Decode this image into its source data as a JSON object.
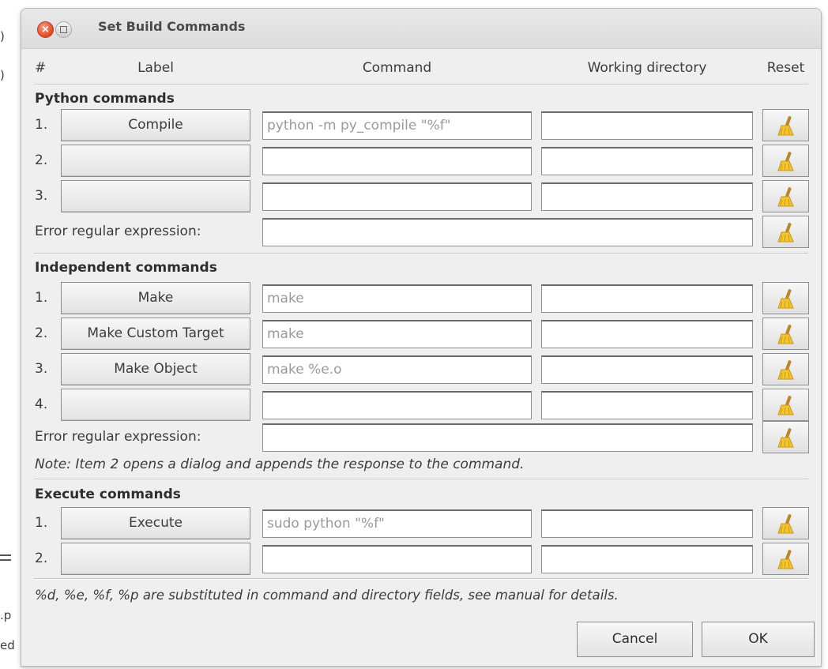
{
  "background": {
    "left_fragments": [
      ")",
      ")",
      ".p",
      "ed"
    ]
  },
  "dialog": {
    "title": "Set Build Commands",
    "headers": {
      "number": "#",
      "label": "Label",
      "command": "Command",
      "working_directory": "Working directory",
      "reset": "Reset"
    },
    "sections": [
      {
        "title": "Python commands",
        "rows": [
          {
            "num": "1.",
            "label": "Compile",
            "command": "python -m py_compile \"%f\"",
            "directory": ""
          },
          {
            "num": "2.",
            "label": "",
            "command": "",
            "directory": ""
          },
          {
            "num": "3.",
            "label": "",
            "command": "",
            "directory": ""
          }
        ],
        "error_label": "Error regular expression:",
        "error_value": ""
      },
      {
        "title": "Independent commands",
        "rows": [
          {
            "num": "1.",
            "label": "Make",
            "command": "make",
            "directory": ""
          },
          {
            "num": "2.",
            "label": "Make Custom Target",
            "command": "make",
            "directory": ""
          },
          {
            "num": "3.",
            "label": "Make Object",
            "command": "make %e.o",
            "directory": ""
          },
          {
            "num": "4.",
            "label": "",
            "command": "",
            "directory": ""
          }
        ],
        "error_label": "Error regular expression:",
        "error_value": "",
        "note": "Note: Item 2 opens a dialog and appends the response to the command."
      },
      {
        "title": "Execute commands",
        "rows": [
          {
            "num": "1.",
            "label": "Execute",
            "command": "sudo python \"%f\"",
            "directory": ""
          },
          {
            "num": "2.",
            "label": "",
            "command": "",
            "directory": ""
          }
        ]
      }
    ],
    "footer_note": "%d, %e, %f, %p are substituted in command and directory fields, see manual for details.",
    "buttons": {
      "cancel": "Cancel",
      "ok": "OK"
    },
    "icons": {
      "close": "close-icon",
      "maximize": "maximize-icon",
      "reset": "broom-icon"
    },
    "colors": {
      "close_button": "#e2532f",
      "broom": "#f2c531"
    }
  }
}
